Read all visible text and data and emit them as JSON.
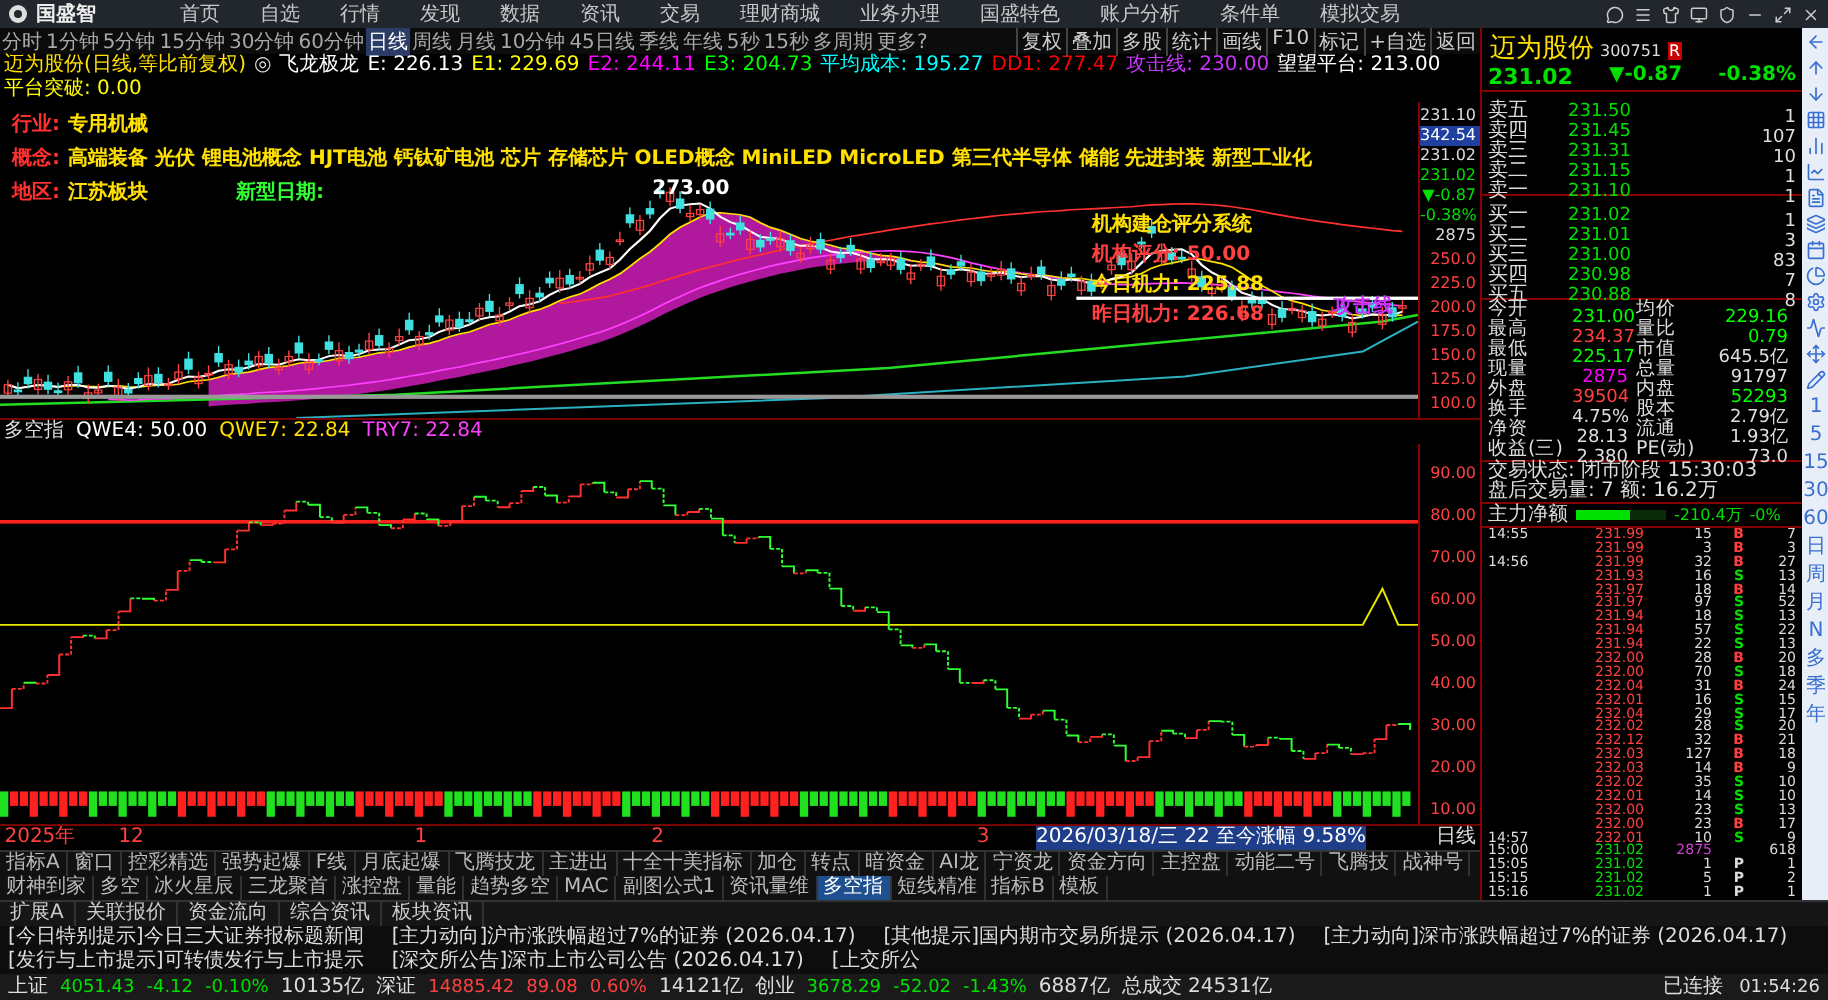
{
  "title_bar": {
    "app_name": "国盛智",
    "menu": [
      "首页",
      "自选",
      "行情",
      "发现",
      "数据",
      "资讯",
      "交易",
      "理财商城",
      "业务办理",
      "国盛特色",
      "账户分析",
      "条件单",
      "模拟交易"
    ]
  },
  "period_tabs": [
    {
      "label": "分时",
      "selected": false
    },
    {
      "label": "1分钟",
      "selected": false
    },
    {
      "label": "5分钟",
      "selected": false
    },
    {
      "label": "15分钟",
      "selected": false
    },
    {
      "label": "30分钟",
      "selected": false
    },
    {
      "label": "60分钟",
      "selected": false
    },
    {
      "label": "日线",
      "selected": true
    },
    {
      "label": "周线",
      "selected": false
    },
    {
      "label": "月线",
      "selected": false
    },
    {
      "label": "10分钟",
      "selected": false
    },
    {
      "label": "45日线",
      "selected": false
    },
    {
      "label": "季线",
      "selected": false
    },
    {
      "label": "年线",
      "selected": false
    },
    {
      "label": "5秒",
      "selected": false
    },
    {
      "label": "15秒",
      "selected": false
    },
    {
      "label": "多周期",
      "selected": false
    },
    {
      "label": "更多?",
      "selected": false
    }
  ],
  "chart_tools": [
    "复权",
    "叠加",
    "多股",
    "统计",
    "画线",
    "F10",
    "标记",
    "+自选",
    "返回"
  ],
  "indicator_line": {
    "title": "迈为股份(日线,等比前复权)",
    "marker": "◎",
    "items": [
      {
        "text": "飞龙极龙",
        "color": "#ffffff"
      },
      {
        "text": "E: 226.13",
        "color": "#ffffff"
      },
      {
        "text": "E1: 229.69",
        "color": "#ffff00"
      },
      {
        "text": "E2: 244.11",
        "color": "#ff00ff"
      },
      {
        "text": "E3: 204.73",
        "color": "#00ff00"
      },
      {
        "text": "平均成本: 195.27",
        "color": "#00ffff"
      },
      {
        "text": "DD1: 277.47",
        "color": "#ff0000"
      },
      {
        "text": "攻击线: 230.00",
        "color": "#cc33ff"
      },
      {
        "text": "望望平台: 213.00",
        "color": "#ffffff"
      },
      {
        "text": "平台突破: 0.00",
        "color": "#ffff00"
      }
    ]
  },
  "stock_info": [
    {
      "label": "行业:",
      "value": "专用机械"
    },
    {
      "label": "概念:",
      "value": "高端装备 光伏 锂电池概念 HJT电池 钙钛矿电池 芯片 存储芯片 OLED概念 MiniLED MicroLED 第三代半导体 储能 先进封装 新型工业化"
    },
    {
      "label": "地区:",
      "value": "江苏板块",
      "note": "新型日期:"
    }
  ],
  "chart_labels": {
    "peak": "273.00",
    "system": [
      "机构建仓评分系统",
      "机构评分: 50.00",
      "今日机力: 225.88",
      "昨日机力: 226.68"
    ],
    "attack_line": "攻击线"
  },
  "price_axis": {
    "markers": [
      "231.10",
      "342.54",
      "231.02"
    ],
    "quote": [
      "231.02",
      "▼-0.87",
      "-0.38%",
      "2875"
    ],
    "ticks": [
      "250.0",
      "225.0",
      "200.0",
      "175.0",
      "150.0",
      "125.0",
      "100.0"
    ]
  },
  "lower_indicator": {
    "name": "多空指",
    "values": [
      "QWE4: 50.00",
      "QWE7: 22.84",
      "TRY7: 22.84"
    ],
    "axis": [
      "90.00",
      "80.00",
      "70.00",
      "60.00",
      "50.00",
      "40.00",
      "30.00",
      "20.00",
      "10.00"
    ]
  },
  "x_axis": {
    "labels": [
      "2025年",
      "12",
      "1",
      "2",
      "3"
    ],
    "range_label": "2026/03/18/三 22 至今涨幅 9.58%",
    "period": "日线"
  },
  "indicator_tabs": [
    {
      "label": "指标A",
      "selected": false
    },
    {
      "label": "窗口",
      "selected": false
    },
    {
      "label": "控彩精选",
      "selected": false
    },
    {
      "label": "强势起爆",
      "selected": false
    },
    {
      "label": "F线",
      "selected": false
    },
    {
      "label": "月底起爆",
      "selected": false
    },
    {
      "label": "飞腾技龙",
      "selected": false
    },
    {
      "label": "主进出",
      "selected": false
    },
    {
      "label": "十全十美指标",
      "selected": false
    },
    {
      "label": "加仓",
      "selected": false
    },
    {
      "label": "转点",
      "selected": false
    },
    {
      "label": "暗资金",
      "selected": false
    },
    {
      "label": "AI龙",
      "selected": false
    },
    {
      "label": "宁资龙",
      "selected": false
    },
    {
      "label": "资金方向",
      "selected": false
    },
    {
      "label": "主控盘",
      "selected": false
    },
    {
      "label": "动能二号",
      "selected": false
    },
    {
      "label": "飞腾技",
      "selected": false
    },
    {
      "label": "战神号",
      "selected": false
    },
    {
      "label": "财神到家",
      "selected": false
    },
    {
      "label": "多空",
      "selected": false
    },
    {
      "label": "冰火星辰",
      "selected": false
    },
    {
      "label": "三龙聚首",
      "selected": false
    },
    {
      "label": "涨控盘",
      "selected": false
    },
    {
      "label": "量能",
      "selected": false
    },
    {
      "label": "趋势多空",
      "selected": false
    },
    {
      "label": "MAC",
      "selected": false
    },
    {
      "label": "副图公式1",
      "selected": false
    },
    {
      "label": "资讯量维",
      "selected": false
    },
    {
      "label": "多空指",
      "selected": true
    },
    {
      "label": "短线精准",
      "selected": false
    },
    {
      "label": "指标B",
      "selected": false
    },
    {
      "label": "模板",
      "selected": false
    }
  ],
  "ext_tabs": [
    "扩展A",
    "关联报价",
    "资金流向",
    "综合资讯",
    "板块资讯"
  ],
  "quote": {
    "name": "迈为股份",
    "code": "300751",
    "badge": "R",
    "price": "231.02",
    "change": "▼-0.87",
    "pct": "-0.38%",
    "asks": [
      {
        "label": "卖五",
        "price": "231.50",
        "volume": "1"
      },
      {
        "label": "卖四",
        "price": "231.45",
        "volume": "107"
      },
      {
        "label": "卖三",
        "price": "231.31",
        "volume": "10"
      },
      {
        "label": "卖二",
        "price": "231.15",
        "volume": "1"
      },
      {
        "label": "卖一",
        "price": "231.10",
        "volume": "1"
      }
    ],
    "bids": [
      {
        "label": "买一",
        "price": "231.02",
        "volume": "1"
      },
      {
        "label": "买二",
        "price": "231.01",
        "volume": "3"
      },
      {
        "label": "买三",
        "price": "231.00",
        "volume": "83"
      },
      {
        "label": "买四",
        "price": "230.98",
        "volume": "7"
      },
      {
        "label": "买五",
        "price": "230.88",
        "volume": "8"
      }
    ],
    "stats": [
      {
        "label": "今开",
        "value": "231.00",
        "color": "#00ff00"
      },
      {
        "label": "均价",
        "value": "229.16",
        "color": "#00ff00"
      },
      {
        "label": "最高",
        "value": "234.37",
        "color": "#ff4040"
      },
      {
        "label": "量比",
        "value": "0.79",
        "color": "#00ff00"
      },
      {
        "label": "最低",
        "value": "225.17",
        "color": "#00ff00"
      },
      {
        "label": "市值",
        "value": "645.5亿",
        "color": "#dddddd"
      },
      {
        "label": "现量",
        "value": "2875",
        "color": "#ff00ff"
      },
      {
        "label": "总量",
        "value": "91797",
        "color": "#dddddd"
      },
      {
        "label": "外盘",
        "value": "39504",
        "color": "#ff4040"
      },
      {
        "label": "内盘",
        "value": "52293",
        "color": "#00ff00"
      },
      {
        "label": "换手",
        "value": "4.75%",
        "color": "#dddddd"
      },
      {
        "label": "股本",
        "value": "2.79亿",
        "color": "#dddddd"
      },
      {
        "label": "净资",
        "value": "28.13",
        "color": "#dddddd"
      },
      {
        "label": "流通",
        "value": "1.93亿",
        "color": "#dddddd"
      },
      {
        "label": "收益(三)",
        "value": "2.380",
        "color": "#dddddd"
      },
      {
        "label": "PE(动)",
        "value": "73.0",
        "color": "#dddddd"
      }
    ],
    "trade_status": [
      "交易状态: 闭市阶段 15:30:03",
      "盘后交易量: 7 额: 16.2万"
    ],
    "main_flow": {
      "label": "主力净额",
      "level": 0.6,
      "amount": "-210.4万",
      "pct": "-0%"
    },
    "ticks": [
      {
        "time": "14:55",
        "price": "231.99",
        "volume": "15",
        "side": "B",
        "count": "7",
        "kind": "buy",
        "up": true
      },
      {
        "price": "231.99",
        "volume": "3",
        "side": "B",
        "count": "3",
        "kind": "buy",
        "up": true
      },
      {
        "time": "14:56",
        "price": "231.99",
        "volume": "32",
        "side": "B",
        "count": "27",
        "kind": "buy",
        "up": true
      },
      {
        "price": "231.93",
        "volume": "16",
        "side": "S",
        "count": "13",
        "kind": "sell",
        "up": true
      },
      {
        "price": "231.97",
        "volume": "18",
        "side": "B",
        "count": "14",
        "kind": "buy",
        "up": true
      },
      {
        "price": "231.97",
        "volume": "97",
        "side": "S",
        "count": "52",
        "kind": "sell",
        "up": true
      },
      {
        "price": "231.94",
        "volume": "18",
        "side": "S",
        "count": "13",
        "kind": "sell",
        "up": true
      },
      {
        "price": "231.94",
        "volume": "57",
        "side": "S",
        "count": "22",
        "kind": "sell",
        "up": true
      },
      {
        "price": "231.94",
        "volume": "22",
        "side": "S",
        "count": "13",
        "kind": "sell",
        "up": true
      },
      {
        "price": "232.00",
        "volume": "28",
        "side": "B",
        "count": "20",
        "kind": "buy",
        "up": true
      },
      {
        "price": "232.00",
        "volume": "70",
        "side": "S",
        "count": "18",
        "kind": "sell",
        "up": true
      },
      {
        "price": "232.04",
        "volume": "31",
        "side": "B",
        "count": "24",
        "kind": "buy",
        "up": true
      },
      {
        "price": "232.01",
        "volume": "16",
        "side": "S",
        "count": "15",
        "kind": "sell",
        "up": true
      },
      {
        "price": "232.04",
        "volume": "29",
        "side": "S",
        "count": "17",
        "kind": "sell",
        "up": true
      },
      {
        "price": "232.02",
        "volume": "28",
        "side": "S",
        "count": "20",
        "kind": "sell",
        "up": true
      },
      {
        "price": "232.12",
        "volume": "32",
        "side": "B",
        "count": "21",
        "kind": "buy",
        "up": true
      },
      {
        "price": "232.03",
        "volume": "127",
        "side": "B",
        "count": "18",
        "kind": "buy",
        "up": true
      },
      {
        "price": "232.03",
        "volume": "14",
        "side": "B",
        "count": "9",
        "kind": "buy",
        "up": true
      },
      {
        "price": "232.02",
        "volume": "35",
        "side": "S",
        "count": "10",
        "kind": "sell",
        "up": true
      },
      {
        "price": "232.01",
        "volume": "14",
        "side": "S",
        "count": "10",
        "kind": "sell",
        "up": true
      },
      {
        "price": "232.00",
        "volume": "23",
        "side": "S",
        "count": "13",
        "kind": "sell",
        "up": true
      },
      {
        "price": "232.00",
        "volume": "23",
        "side": "B",
        "count": "17",
        "kind": "buy",
        "up": true
      },
      {
        "time": "14:57",
        "price": "232.01",
        "volume": "10",
        "side": "S",
        "count": "9",
        "kind": "sell",
        "up": true
      },
      {
        "time": "15:00",
        "price": "231.02",
        "volume": "2875",
        "count": "618",
        "kind": "auction",
        "up": false
      },
      {
        "time": "15:05",
        "price": "231.02",
        "volume": "1",
        "side": "P",
        "count": "1",
        "kind": "neutral",
        "up": false
      },
      {
        "time": "15:15",
        "price": "231.02",
        "volume": "5",
        "side": "P",
        "count": "2",
        "kind": "neutral",
        "up": false
      },
      {
        "time": "15:16",
        "price": "231.02",
        "volume": "1",
        "side": "P",
        "count": "1",
        "kind": "neutral",
        "up": false
      }
    ]
  },
  "side_periods": [
    "1",
    "5",
    "15",
    "30",
    "60",
    "日",
    "周",
    "月",
    "N",
    "多",
    "季",
    "年"
  ],
  "ticker": [
    "[今日特别提示]今日三大证券报标题新闻",
    "[主力动向]沪市涨跌幅超过7%的证券 (2026.04.17)",
    "[其他提示]国内期市交易所提示 (2026.04.17)",
    "[主力动向]深市涨跌幅超过7%的证券 (2026.04.17)",
    "[发行与上市提示]可转债发行与上市提示",
    "[深交所公告]深市上市公司公告 (2026.04.17)",
    "[上交所公"
  ],
  "status_bar": {
    "indices": [
      {
        "name": "上证",
        "value": "4051.43",
        "change": "-4.12",
        "pct": "-0.10%",
        "amount": "10135亿",
        "up": false
      },
      {
        "name": "深证",
        "value": "14885.42",
        "change": "89.08",
        "pct": "0.60%",
        "amount": "14121亿",
        "up": true
      },
      {
        "name": "创业",
        "value": "3678.29",
        "change": "-52.02",
        "pct": "-1.43%",
        "amount": "6887亿",
        "up": false
      }
    ],
    "total": "总成交 24531亿",
    "connection": "已连接",
    "time": "01:54:26"
  }
}
